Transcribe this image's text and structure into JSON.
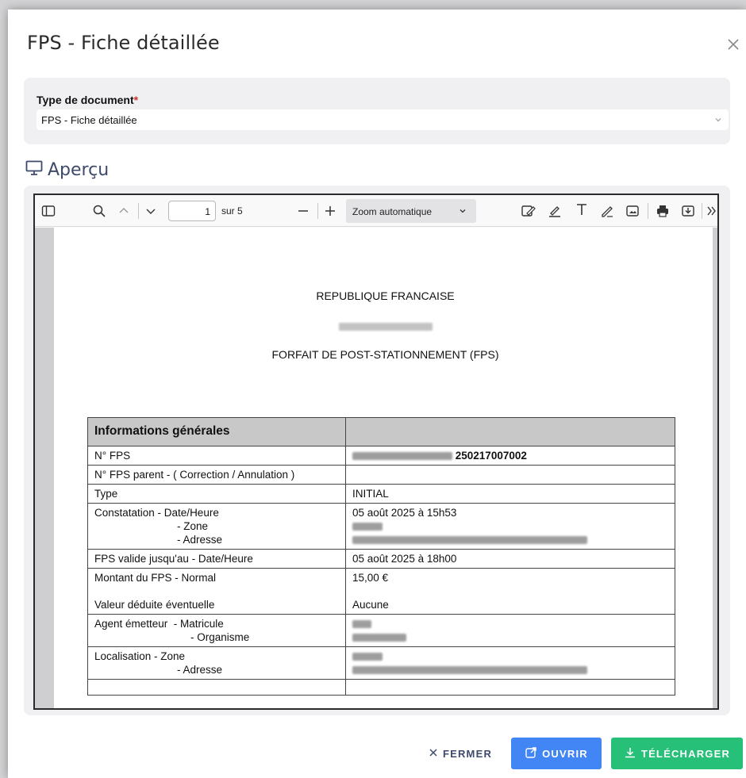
{
  "modal": {
    "title": "FPS - Fiche détaillée",
    "close_icon": "close-icon"
  },
  "document_type": {
    "label": "Type de document",
    "required_mark": "*",
    "selected": "FPS - Fiche détaillée"
  },
  "preview": {
    "heading": "Aperçu",
    "icon": "monitor-icon"
  },
  "viewer": {
    "page_number": "1",
    "page_of": "sur 5",
    "zoom": "Zoom automatique"
  },
  "document": {
    "heading1": "REPUBLIQUE FRANCAISE",
    "heading3": "FORFAIT DE POST-STATIONNEMENT (FPS)",
    "table_header": "Informations générales",
    "rows": {
      "fps_label": "N° FPS",
      "fps_value": "250217007002",
      "parent_label": "N° FPS parent - ( Correction / Annulation )",
      "type_label": "Type",
      "type_value": "INITIAL",
      "constat_label": "Constatation - Date/Heure",
      "constat_zone": "- Zone",
      "constat_adresse": "- Adresse",
      "constat_value": "05 août 2025 à 15h53",
      "valid_label": "FPS valide jusqu'au - Date/Heure",
      "valid_value": "05 août 2025 à 18h00",
      "montant_label": "Montant du FPS - Normal",
      "montant_value": "15,00 €",
      "deduite_label": "Valeur déduite éventuelle",
      "deduite_value": "Aucune",
      "agent_label": "Agent émetteur  - Matricule",
      "agent_org": "- Organisme",
      "loc_label": "Localisation - Zone",
      "loc_adresse": "- Adresse"
    }
  },
  "footer": {
    "close_label": "FERMER",
    "open_label": "OUVRIR",
    "download_label": "TÉLÉCHARGER"
  },
  "colors": {
    "open_button": "#4285f4",
    "download_button": "#27c078",
    "secondary_text": "#3e4a6b",
    "required": "#d0342c"
  }
}
